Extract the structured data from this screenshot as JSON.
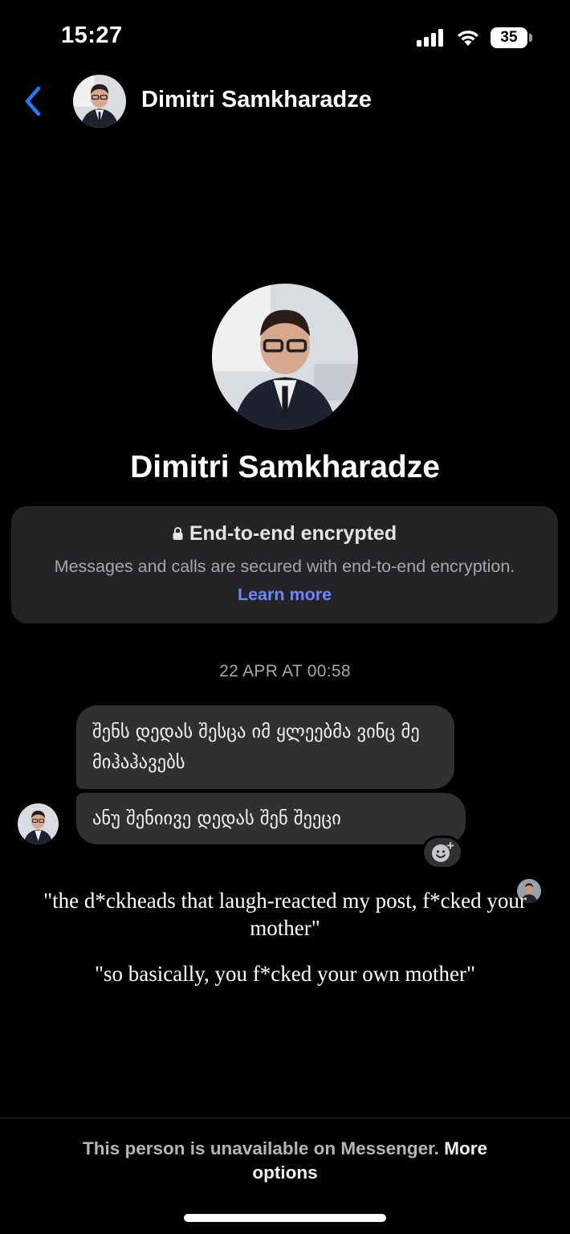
{
  "status_bar": {
    "time": "15:27",
    "battery": "35"
  },
  "header": {
    "contact_name": "Dimitri Samkharadze"
  },
  "profile": {
    "name": "Dimitri Samkharadze"
  },
  "encryption": {
    "title": "End-to-end encrypted",
    "body": "Messages and calls are secured with end-to-end encryption.",
    "link": "Learn more"
  },
  "thread": {
    "timestamp": "22 APR AT 00:58",
    "messages": [
      {
        "text": "შენს დედას შესცა იმ ყლეებმა ვინც მე მიჰაჰავებს"
      },
      {
        "text": "ანუ შენიივე დედას შენ შეეცი"
      }
    ]
  },
  "translations": {
    "line1": "\"the d*ckheads that laugh-reacted my post, f*cked your mother\"",
    "line2": "\"so basically, you f*cked your own mother\""
  },
  "footer": {
    "text": "This person is unavailable on Messenger.",
    "link": "More options"
  },
  "icons": {
    "back": "chevron-left-icon",
    "lock": "lock-icon",
    "reaction": "add-reaction-icon",
    "signal": "cellular-signal-icon",
    "wifi": "wifi-icon"
  },
  "colors": {
    "background": "#000000",
    "bubble": "#303032",
    "card": "#242426",
    "accent": "#1e7bff",
    "link": "#6b86ff"
  }
}
